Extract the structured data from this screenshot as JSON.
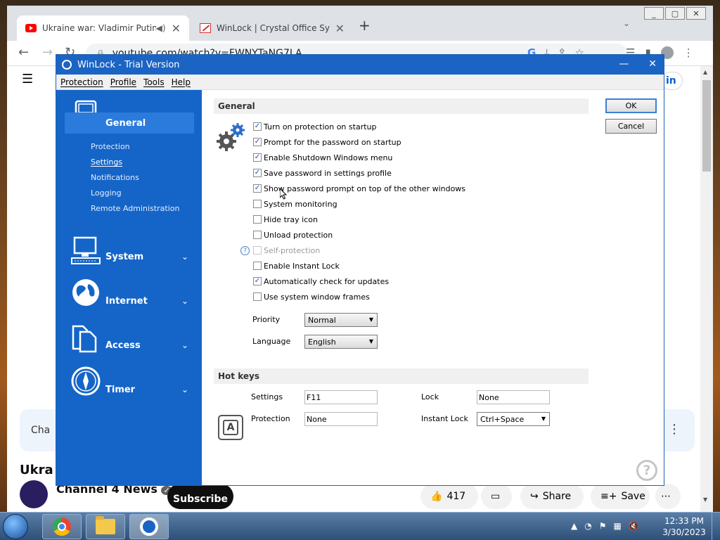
{
  "browser": {
    "tabs": [
      {
        "title": "Ukraine war: Vladimir Putin to",
        "icon": "youtube-icon",
        "sound": true
      },
      {
        "title": "WinLock | Crystal Office Systems",
        "icon": "winlock-icon"
      }
    ],
    "url": "youtube.com/watch?v=FWNYTaNG7LA",
    "window_controls": [
      "_",
      "▢",
      "✕"
    ]
  },
  "youtube": {
    "signin": "in",
    "chat_label": "Cha",
    "title_fragment": "Ukra",
    "channel": "Channel 4 News",
    "subscribe": "Subscribe",
    "likes": "417",
    "share": "Share",
    "save": "Save"
  },
  "dialog": {
    "title": "WinLock - Trial Version",
    "menu": [
      "Protection",
      "Profile",
      "Tools",
      "Help"
    ],
    "ok": "OK",
    "cancel": "Cancel",
    "accent": "#1565c8"
  },
  "sidebar": {
    "sections": [
      {
        "label": "General",
        "icon": "general-icon",
        "selected": true
      },
      {
        "label": "System",
        "icon": "system-icon"
      },
      {
        "label": "Internet",
        "icon": "internet-icon"
      },
      {
        "label": "Access",
        "icon": "access-icon"
      },
      {
        "label": "Timer",
        "icon": "timer-icon"
      }
    ],
    "general_items": [
      "Protection",
      "Settings",
      "Notifications",
      "Logging",
      "Remote Administration"
    ],
    "active_item": "Settings"
  },
  "general": {
    "heading": "General",
    "options": [
      {
        "label": "Turn on protection on startup",
        "checked": true
      },
      {
        "label": "Prompt for the password on startup",
        "checked": true
      },
      {
        "label": "Enable Shutdown Windows menu",
        "checked": true
      },
      {
        "label": "Save password in settings profile",
        "checked": true
      },
      {
        "label": "Show password prompt on top of the other windows",
        "checked": true
      },
      {
        "label": "System monitoring",
        "checked": false
      },
      {
        "label": "Hide tray icon",
        "checked": false
      },
      {
        "label": "Unload protection",
        "checked": false
      },
      {
        "label": "Self-protection",
        "checked": false,
        "disabled": true
      },
      {
        "label": "Enable Instant Lock",
        "checked": false
      },
      {
        "label": "Automatically check for updates",
        "checked": true
      },
      {
        "label": "Use system window frames",
        "checked": false
      }
    ],
    "priority_label": "Priority",
    "priority_value": "Normal",
    "language_label": "Language",
    "language_value": "English"
  },
  "hotkeys": {
    "heading": "Hot keys",
    "settings_label": "Settings",
    "settings_value": "F11",
    "protection_label": "Protection",
    "protection_value": "None",
    "lock_label": "Lock",
    "lock_value": "None",
    "instant_lock_label": "Instant Lock",
    "instant_lock_value": "Ctrl+Space"
  },
  "taskbar": {
    "time": "12:33 PM",
    "date": "3/30/2023"
  }
}
